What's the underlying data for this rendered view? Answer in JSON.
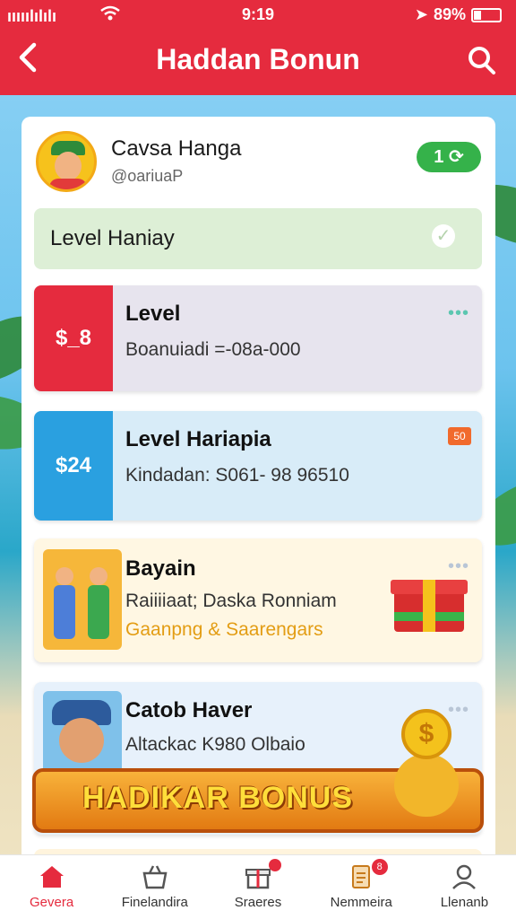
{
  "status_bar": {
    "signal": "ııııılılılı",
    "time": "9:19",
    "battery": "89%"
  },
  "header": {
    "title": "Haddan Bonun"
  },
  "profile": {
    "name": "Cavsa Hanga",
    "subtitle": "@oariuaP",
    "badge": "1"
  },
  "level_bar": {
    "label": "Level Haniay"
  },
  "cards": [
    {
      "side": "$_8",
      "title": "Level",
      "line": "Boanuiadi =-08a-000"
    },
    {
      "side": "$24",
      "title": "Level Hariapia",
      "line": "Kindadan: S061- 98 96510",
      "tag": "50"
    },
    {
      "title": "Bayain",
      "line": "Raiiiiaat; Daska Ronniam",
      "line2": "Gaanpng & Saarengars"
    },
    {
      "title": "Catob Haver",
      "line": "Altackac K980 Olbaio"
    }
  ],
  "banner": {
    "text": "HADIKAR BONUS",
    "coin": "$"
  },
  "tabs": [
    {
      "label": "Gevera",
      "active": true
    },
    {
      "label": "Finelandira"
    },
    {
      "label": "Sraeres",
      "badge": ""
    },
    {
      "label": "Nemmeira",
      "badge": "8"
    },
    {
      "label": "Llenanb"
    }
  ],
  "colors": {
    "primary": "#e52b3e",
    "green": "#35b24a",
    "blue": "#2aa0e0",
    "banner": "#f8b23a"
  }
}
